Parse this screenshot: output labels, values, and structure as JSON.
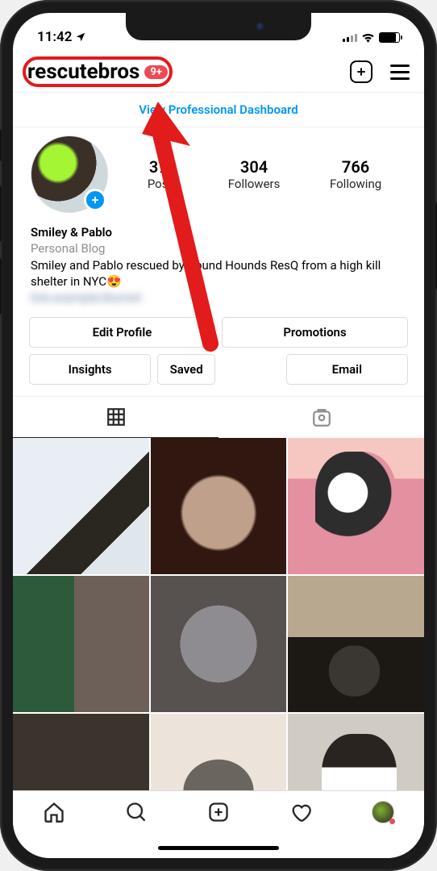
{
  "status": {
    "time": "11:42"
  },
  "header": {
    "username": "rescutebros",
    "badge": "9+"
  },
  "dashboard_link": "View Professional Dashboard",
  "stats": {
    "posts": {
      "count": "370",
      "label": "Posts"
    },
    "followers": {
      "count": "304",
      "label": "Followers"
    },
    "following": {
      "count": "766",
      "label": "Following"
    }
  },
  "bio": {
    "display_name": "Smiley & Pablo",
    "category": "Personal Blog",
    "text": "Smiley and Pablo rescued by Pound Hounds ResQ from a high kill shelter in NYC😍"
  },
  "buttons": {
    "edit_profile": "Edit Profile",
    "promotions": "Promotions",
    "insights": "Insights",
    "saved": "Saved",
    "email": "Email"
  }
}
